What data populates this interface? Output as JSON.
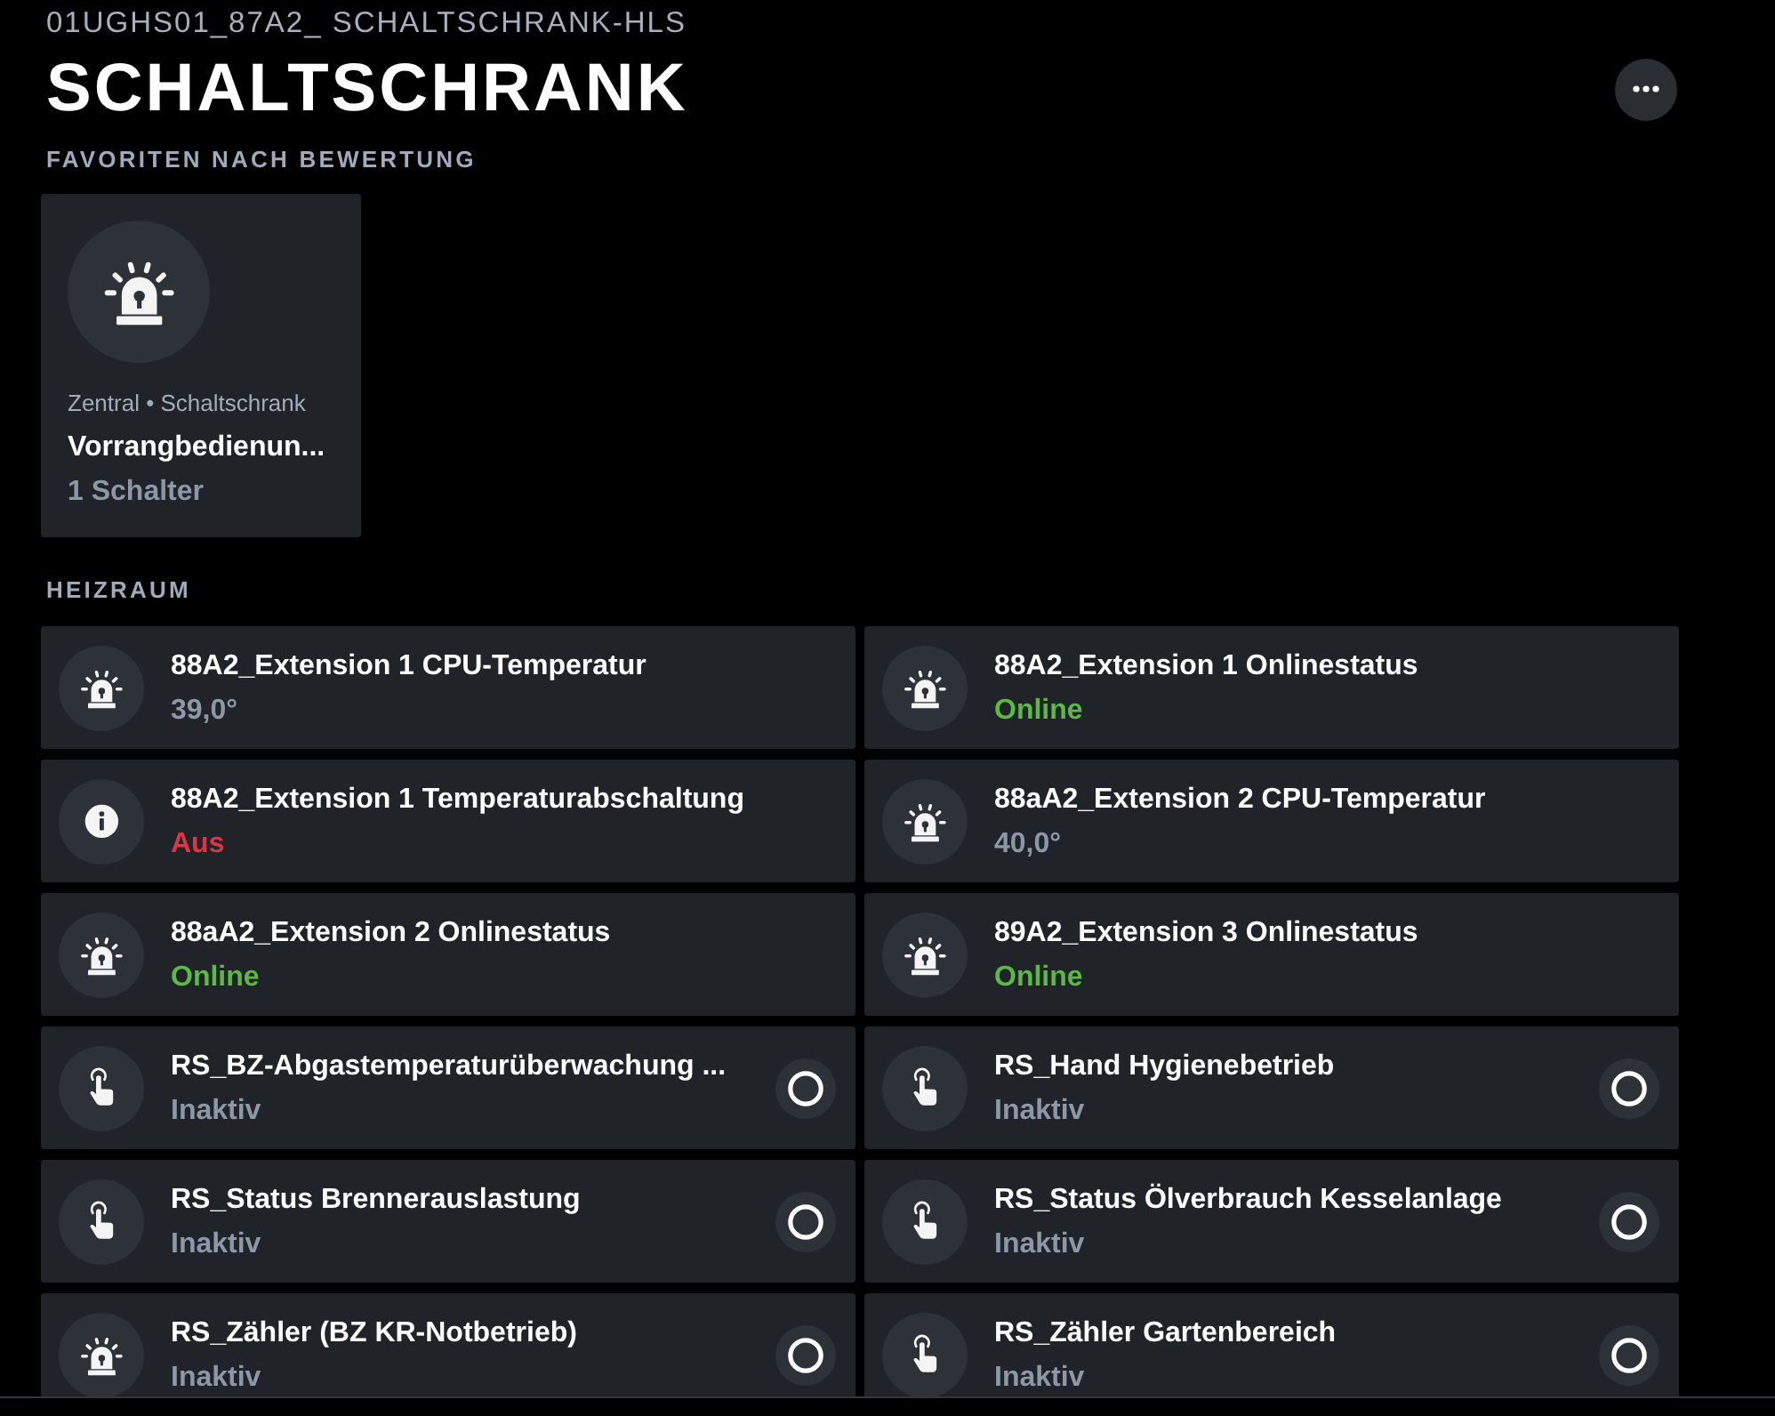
{
  "header": {
    "breadcrumb": "01UGHS01_87A2_ SCHALTSCHRANK-HLS",
    "title": "SCHALTSCHRANK"
  },
  "favorites": {
    "heading": "FAVORITEN NACH BEWERTUNG",
    "cards": [
      {
        "kind": "alarm",
        "location": "Zentral • Schaltschrank",
        "name": "Vorrangbedienun...",
        "summary": "1 Schalter"
      }
    ]
  },
  "sections": [
    {
      "heading": "HEIZRAUM",
      "tiles": [
        {
          "kind": "alarm",
          "title": "88A2_Extension 1 CPU-Temperatur",
          "value": "39,0°",
          "color": "#8c98a8"
        },
        {
          "kind": "alarm",
          "title": "88A2_Extension 1 Onlinestatus",
          "value": "Online",
          "color": "#5cb946"
        },
        {
          "kind": "info",
          "title": "88A2_Extension 1 Temperaturabschaltung",
          "value": "Aus",
          "color": "#dc3545"
        },
        {
          "kind": "alarm",
          "title": "88aA2_Extension 2 CPU-Temperatur",
          "value": "40,0°",
          "color": "#8c98a8"
        },
        {
          "kind": "alarm",
          "title": "88aA2_Extension 2 Onlinestatus",
          "value": "Online",
          "color": "#5cb946"
        },
        {
          "kind": "alarm",
          "title": "89A2_Extension 3 Onlinestatus",
          "value": "Online",
          "color": "#5cb946"
        },
        {
          "kind": "action",
          "title": "RS_BZ-Abgastemperaturüberwachung ...",
          "value": "Inaktiv",
          "color": "#8c98a8",
          "switch": {
            "on": false
          }
        },
        {
          "kind": "action",
          "title": "RS_Hand Hygienebetrieb",
          "value": "Inaktiv",
          "color": "#8c98a8",
          "switch": {
            "on": false
          }
        },
        {
          "kind": "action",
          "title": "RS_Status Brennerauslastung",
          "value": "Inaktiv",
          "color": "#8c98a8",
          "switch": {
            "on": false
          }
        },
        {
          "kind": "action",
          "title": "RS_Status Ölverbrauch Kesselanlage",
          "value": "Inaktiv",
          "color": "#8c98a8",
          "switch": {
            "on": false
          }
        },
        {
          "kind": "alarm",
          "title": "RS_Zähler (BZ KR-Notbetrieb)",
          "value": "Inaktiv",
          "color": "#8c98a8",
          "switch": {
            "on": false
          }
        },
        {
          "kind": "action",
          "title": "RS_Zähler Gartenbereich",
          "value": "Inaktiv",
          "color": "#8c98a8",
          "switch": {
            "on": false
          }
        }
      ]
    }
  ]
}
